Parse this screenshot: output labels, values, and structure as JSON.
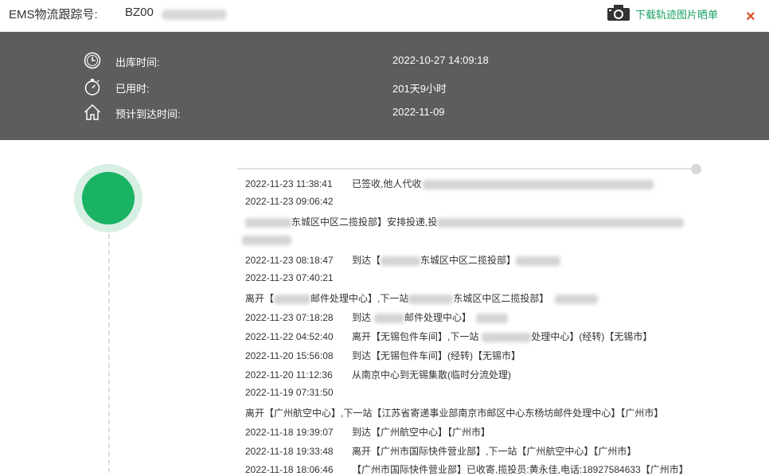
{
  "header": {
    "tracking_label": "EMS物流跟踪号:",
    "tracking_number_prefix": "BZ00",
    "download_label": "下载轨迹图片晒单",
    "close_label": "×"
  },
  "summary": {
    "rows": [
      {
        "icon": "clock-icon",
        "label": "出库时间:",
        "value": "2022-10-27 14:09:18"
      },
      {
        "icon": "stopwatch-icon",
        "label": "已用时:",
        "value": "201天9小时"
      },
      {
        "icon": "home-icon",
        "label": "预计到达时间:",
        "value": "2022-11-09"
      }
    ]
  },
  "timeline": {
    "accent_color": "#1ab364",
    "events": [
      {
        "time": "2022-11-23 11:38:41",
        "text": "已签收,他人代收"
      },
      {
        "time": "2022-11-23 09:06:42",
        "text": ""
      },
      {
        "time": "",
        "text": "东城区中区二揽投部】安排投递,投"
      },
      {
        "time": "2022-11-23 08:18:47",
        "text": "到达【",
        "text2": "东城区中区二揽投部】"
      },
      {
        "time": "2022-11-23 07:40:21",
        "text": ""
      },
      {
        "time": "",
        "text": "离开【",
        "text2": "邮件处理中心】,下一站",
        "text3": "东城区中区二揽投部】"
      },
      {
        "time": "2022-11-23 07:18:28",
        "text": "到达",
        "text2": "邮件处理中心】"
      },
      {
        "time": "2022-11-22 04:52:40",
        "text": "离开【无锡包件车间】,下一站",
        "text2": "处理中心】(经转)【无锡市】"
      },
      {
        "time": "2022-11-20 15:56:08",
        "text": "到达【无锡包件车间】(经转)【无锡市】"
      },
      {
        "time": "2022-11-20 11:12:36",
        "text": "从南京中心到无锡集散(临时分流处理)"
      },
      {
        "time": "2022-11-19 07:31:50",
        "text": ""
      },
      {
        "time": "",
        "text": "离开【广州航空中心】,下一站【江苏省寄递事业部南京市邮区中心东杨坊邮件处理中心】【广州市】"
      },
      {
        "time": "2022-11-18 19:39:07",
        "text": "到达【广州航空中心】【广州市】"
      },
      {
        "time": "2022-11-18 19:33:48",
        "text": "离开【广州市国际快件营业部】,下一站【广州航空中心】【广州市】"
      },
      {
        "time": "2022-11-18 18:06:46",
        "text": "【广州市国际快件营业部】已收寄,揽投员:黄永佳,电话:18927584633【广州市】"
      }
    ]
  }
}
